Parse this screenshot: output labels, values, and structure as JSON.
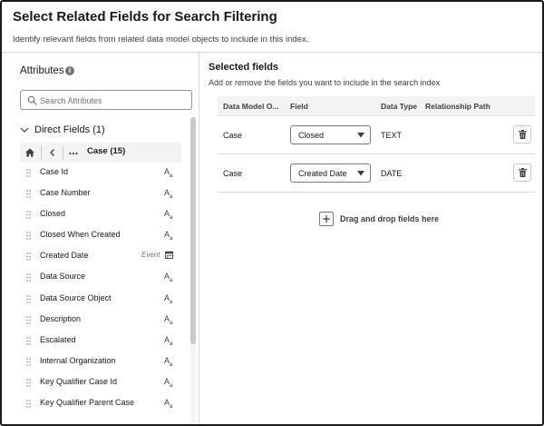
{
  "header": {
    "title": "Select Related Fields for Search Filtering",
    "subtitle": "Identify relevant fields from related data model objects to include in this index."
  },
  "attributes": {
    "title": "Attributes",
    "info_icon": "info-icon",
    "search": {
      "placeholder": "Search Attributes",
      "value": ""
    },
    "section_label": "Direct Fields (1)",
    "nav": {
      "current": "Case (15)",
      "icons": [
        "home-icon",
        "back-icon",
        "more-icon"
      ]
    },
    "fields": [
      {
        "label": "Case Id",
        "type_icon": "text-type-icon"
      },
      {
        "label": "Case Number",
        "type_icon": "text-type-icon"
      },
      {
        "label": "Closed",
        "type_icon": "text-type-icon"
      },
      {
        "label": "Closed When Created",
        "type_icon": "text-type-icon"
      },
      {
        "label": "Created Date",
        "type_icon": "calendar-icon",
        "tag": "Event"
      },
      {
        "label": "Data Source",
        "type_icon": "text-type-icon"
      },
      {
        "label": "Data Source Object",
        "type_icon": "text-type-icon"
      },
      {
        "label": "Description",
        "type_icon": "text-type-icon"
      },
      {
        "label": "Escalated",
        "type_icon": "text-type-icon"
      },
      {
        "label": "Internal Organization",
        "type_icon": "text-type-icon"
      },
      {
        "label": "Key Qualifier Case Id",
        "type_icon": "text-type-icon"
      },
      {
        "label": "Key Qualifier Parent Case",
        "type_icon": "text-type-icon"
      }
    ]
  },
  "selected": {
    "title": "Selected fields",
    "subtitle": "Add or remove the fields you want to include in the search index",
    "columns": [
      "Data Model O...",
      "Field",
      "Data Type",
      "Relationship Path"
    ],
    "rows": [
      {
        "object": "Case",
        "field": "Closed",
        "data_type": "TEXT",
        "path": ""
      },
      {
        "object": "Case",
        "field": "Created Date",
        "data_type": "DATE",
        "path": ""
      }
    ],
    "drop_label": "Drag and drop fields here"
  }
}
